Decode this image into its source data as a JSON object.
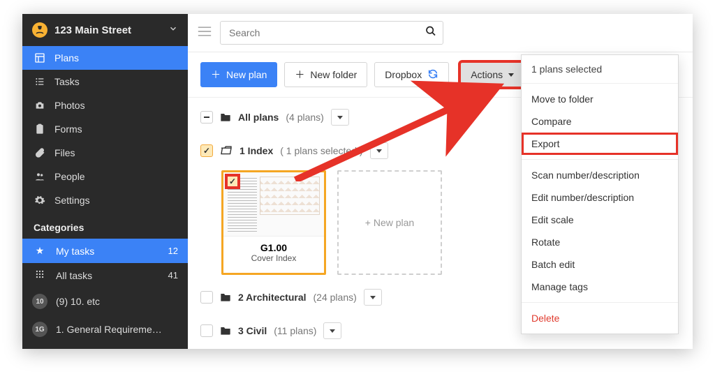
{
  "project": {
    "title": "123 Main Street"
  },
  "sidebar": {
    "items": [
      {
        "label": "Plans"
      },
      {
        "label": "Tasks"
      },
      {
        "label": "Photos"
      },
      {
        "label": "Forms"
      },
      {
        "label": "Files"
      },
      {
        "label": "People"
      },
      {
        "label": "Settings"
      }
    ],
    "section_title": "Categories",
    "categories": [
      {
        "label": "My tasks",
        "count": "12"
      },
      {
        "label": "All tasks",
        "count": "41"
      },
      {
        "pill": "10",
        "label": "(9) 10. etc"
      },
      {
        "pill": "1G",
        "label": "1. General Requireme…"
      }
    ]
  },
  "search": {
    "placeholder": "Search"
  },
  "toolbar": {
    "new_plan": "New plan",
    "new_folder": "New folder",
    "dropbox": "Dropbox",
    "actions": "Actions"
  },
  "folders": {
    "all": {
      "name": "All plans",
      "sub": "(4 plans)"
    },
    "index": {
      "name": "1 Index",
      "sub": "( 1 plans selected )"
    },
    "arch": {
      "name": "2 Architectural",
      "sub": "(24 plans)"
    },
    "civil": {
      "name": "3 Civil",
      "sub": "(11 plans)"
    }
  },
  "plan_card": {
    "number": "G1.00",
    "title": "Cover Index"
  },
  "new_plan_card": "+ New plan",
  "actions_menu": {
    "header": "1 plans selected",
    "items": [
      "Move to folder",
      "Compare",
      "Export",
      "Scan number/description",
      "Edit number/description",
      "Edit scale",
      "Rotate",
      "Batch edit",
      "Manage tags",
      "Delete"
    ]
  }
}
